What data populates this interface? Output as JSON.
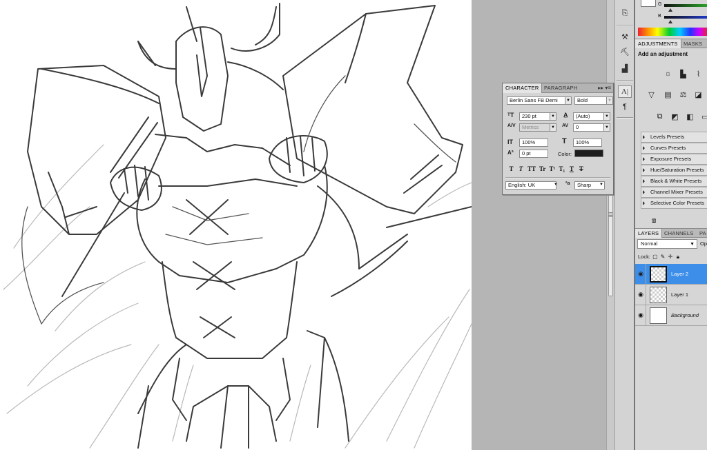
{
  "color_panel": {
    "labels": [
      "G",
      "B"
    ],
    "colors": {
      "green_bar": "#2aa52a",
      "blue_bar": "#1f39c9"
    }
  },
  "adjustments": {
    "tabs": [
      "ADJUSTMENTS",
      "MASKS"
    ],
    "title": "Add an adjustment",
    "icons": [
      "brightness-contrast-icon",
      "levels-icon",
      "curves-icon",
      "exposure-icon",
      "vibrance-icon",
      "hue-saturation-icon",
      "color-balance-icon",
      "black-white-icon",
      "photo-filter-icon",
      "channel-mixer-icon",
      "invert-icon",
      "posterize-icon"
    ],
    "presets": [
      "Levels Presets",
      "Curves Presets",
      "Exposure Presets",
      "Hue/Saturation Presets",
      "Black & White Presets",
      "Channel Mixer Presets",
      "Selective Color Presets"
    ]
  },
  "layers": {
    "tabs": [
      "LAYERS",
      "CHANNELS",
      "PA"
    ],
    "blend_mode": "Normal",
    "opacity_label": "Op",
    "lock_label": "Lock:",
    "items": [
      {
        "name": "Layer 2",
        "selected": true
      },
      {
        "name": "Layer 1",
        "selected": false
      },
      {
        "name": "Background",
        "selected": false
      }
    ]
  },
  "character": {
    "tabs": [
      "CHARACTER",
      "PARAGRAPH"
    ],
    "font_family": "Berlin Sans FB Demi",
    "font_style": "Bold",
    "font_size": "230 pt",
    "leading": "(Auto)",
    "kerning": "Metrics",
    "tracking": "0",
    "vertical_scale": "100%",
    "horizontal_scale": "100%",
    "baseline_shift": "0 pt",
    "color_label": "Color:",
    "text_color": "#1d1d1d",
    "style_buttons": [
      "T",
      "T",
      "TT",
      "Tr",
      "T¹",
      "T₁",
      "T",
      "T"
    ],
    "language": "English: UK",
    "aa_label": "ªa",
    "antialias": "Sharp"
  }
}
